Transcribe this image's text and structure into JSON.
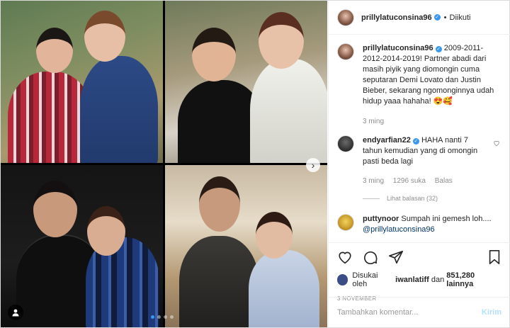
{
  "header": {
    "username": "prillylatuconsina96",
    "follow_label": "Diikuti",
    "separator": "•"
  },
  "caption": {
    "username": "prillylatuconsina96",
    "text": "2009-2011-2012-2014-2019! Partner abadi dari masih piyik yang diomongin cuma seputaran Demi Lovato dan Justin Bieber, sekarang ngomonginnya udah hidup yaaa hahaha! 😍🥰",
    "time": "3 ming"
  },
  "comments": [
    {
      "username": "endyarfian22",
      "text": "HAHA nanti 7 tahun kemudian yang di omongin pasti beda lagi",
      "time": "3 ming",
      "likes": "1296 suka",
      "reply_label": "Balas",
      "view_replies": "Lihat balasan (32)"
    },
    {
      "username": "puttynoor",
      "text": "Sumpah ini gemesh loh....",
      "mention": "@prillylatuconsina96"
    }
  ],
  "likes": {
    "prefix": "Disukai oleh",
    "user": "iwanlatiff",
    "middle": "dan",
    "count": "851,280 lainnya"
  },
  "date": "3 NOVEMBER",
  "add_comment": {
    "placeholder": "Tambahkan komentar...",
    "post_label": "Kirim"
  },
  "media": {
    "photo_count": 4,
    "current_index": 0,
    "nav_glyph": "›"
  },
  "icons": [
    "heart-icon",
    "comment-icon",
    "share-icon",
    "bookmark-icon",
    "tag-user-icon",
    "verified-icon"
  ],
  "colors": {
    "accent": "#3897f0",
    "text": "#262626",
    "muted": "#8e8e8e",
    "post_button_disabled": "#b2dffc"
  }
}
